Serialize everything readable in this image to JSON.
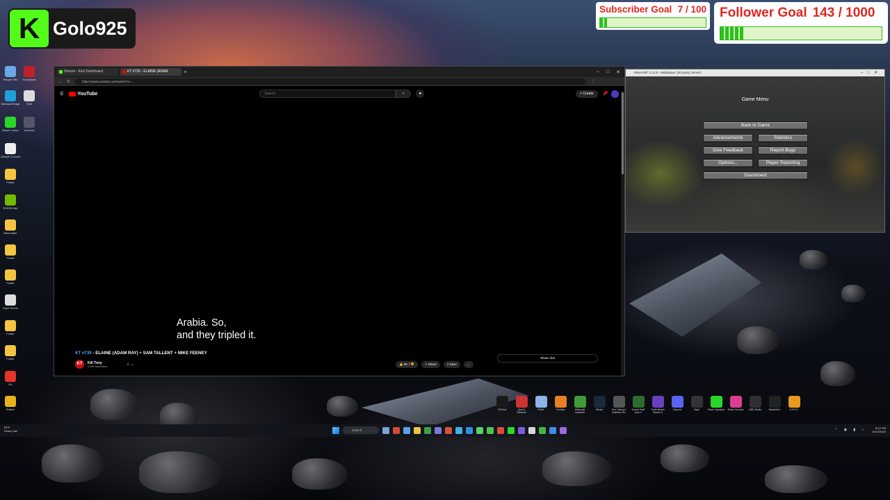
{
  "overlay": {
    "brand_name": "Golo925",
    "brand_logo": "K",
    "subscriber_goal": {
      "label": "Subscriber Goal",
      "value": "7 / 100",
      "progress": 0.07
    },
    "follower_goal": {
      "label": "Follower Goal",
      "value": "143 / 1000",
      "progress": 0.143
    }
  },
  "desktop_icons": [
    {
      "label": "Recycle Bin",
      "icon": "recycle-bin-icon",
      "color": "#6aa8e8"
    },
    {
      "label": "Soundpad",
      "icon": "soundpad-icon",
      "color": "#c0202a"
    },
    {
      "label": "Microsoft Edge",
      "icon": "edge-icon",
      "color": "#1fa0d8"
    },
    {
      "label": "RollI",
      "icon": "file-icon",
      "color": "#dcdcdc"
    },
    {
      "label": "Razer Cortex",
      "icon": "razer-icon",
      "color": "#2bd62b"
    },
    {
      "label": "Vencord",
      "icon": "vencord-icon",
      "color": "#556"
    },
    {
      "label": "Ubisoft Connect",
      "icon": "ubisoft-icon",
      "color": "#eee"
    },
    {
      "label": "Folder",
      "icon": "folder-icon",
      "color": "#f4c542"
    },
    {
      "label": "NVIDIA App",
      "icon": "nvidia-icon",
      "color": "#76b900"
    },
    {
      "label": "New folder",
      "icon": "folder-icon",
      "color": "#f4c542"
    },
    {
      "label": "FiveM",
      "icon": "folder-icon",
      "color": "#f4c542"
    },
    {
      "label": "Folder",
      "icon": "folder-icon",
      "color": "#f4c542"
    },
    {
      "label": "DayZ Server",
      "icon": "dayz-icon",
      "color": "#ddd"
    },
    {
      "label": "Folder",
      "icon": "folder-icon",
      "color": "#f4c542"
    },
    {
      "label": "Folder",
      "icon": "folder-icon",
      "color": "#f4c542"
    },
    {
      "label": "EA",
      "icon": "ea-icon",
      "color": "#e3332a"
    },
    {
      "label": "Roblox",
      "icon": "roblox-icon",
      "color": "#e8b31a"
    }
  ],
  "browser": {
    "tabs": [
      {
        "label": "Stream - Kick Dashboard",
        "color": "#53fc18"
      },
      {
        "label": "KT #739 - ELAINE (ADAM",
        "color": "#ff0000"
      }
    ],
    "new_tab": "+",
    "url": "https://www.youtube.com/watch?v=...",
    "youtube": {
      "logo_text": "YouTube",
      "search_placeholder": "Search",
      "create_label": "+ Create"
    },
    "video": {
      "caption_line1": "Arabia. So,",
      "caption_line2": "and they tripled it.",
      "episode": "KT #739",
      "title_rest": " - ELAINE (ADAM RAY) + SAM TALLENT + MIKE FEENEY",
      "channel_name": "Kill Tony",
      "channel_subs": "3.40M subscribers",
      "channel_avatar": "KT",
      "like_count": "8K",
      "share_label": "Share",
      "save_label": "Save",
      "show_chat_label": "Show chat"
    }
  },
  "minecraft": {
    "window_title": "Minecraft* 1.21.8 - Multiplayer (3rd-party Server)",
    "menu_title": "Game Menu",
    "buttons": {
      "back": "Back to Game",
      "advancements": "Advancements",
      "statistics": "Statistics",
      "feedback": "Give Feedback",
      "bugs": "Report Bugs",
      "options": "Options...",
      "player_reporting": "Player Reporting",
      "disconnect": "Disconnect"
    }
  },
  "shortcuts": [
    {
      "label": "VRChat",
      "color": "#1a1a1a"
    },
    {
      "label": "Quiz & Random",
      "color": "#c33"
    },
    {
      "label": "PEAK",
      "color": "#8fb4e8"
    },
    {
      "label": "Foxhole",
      "color": "#e87f22"
    },
    {
      "label": "Minecraft Launcher",
      "color": "#3f9b3a"
    },
    {
      "label": "Steam",
      "color": "#1b2838"
    },
    {
      "label": "Tom Clancy's Rainbow Six",
      "color": "#555"
    },
    {
      "label": "Grand Theft Auto V",
      "color": "#2e6b2e"
    },
    {
      "label": "Turtle Beach Swarm II",
      "color": "#6b3fc1"
    },
    {
      "label": "Discord",
      "color": "#5865f2"
    },
    {
      "label": "DayZ",
      "color": "#333"
    },
    {
      "label": "Razer Synapse",
      "color": "#2bd62b"
    },
    {
      "label": "Razer Chroma",
      "color": "#d93f8e"
    },
    {
      "label": "OBS Studio",
      "color": "#302e31"
    },
    {
      "label": "MediaServ",
      "color": "#222"
    },
    {
      "label": "S.F.R.D.",
      "color": "#e79a1b"
    }
  ],
  "taskbar": {
    "weather_temp": "63°F",
    "weather_desc": "Heavy rain",
    "search_label": "Search",
    "time": "8:12 PM",
    "date": "10/13/2025",
    "app_colors": [
      "#7aa6d8",
      "#d24b3e",
      "#5aa0e8",
      "#e8c542",
      "#3fa04a",
      "#7a7ad8",
      "#d8513a",
      "#3cb3e8",
      "#2f8ee0",
      "#5ccf6a",
      "#4fc24a",
      "#e04a3a",
      "#2bd62b",
      "#7c5ae0",
      "#d8d8d8",
      "#46b346",
      "#3c8ee8",
      "#9b6ae0"
    ]
  }
}
